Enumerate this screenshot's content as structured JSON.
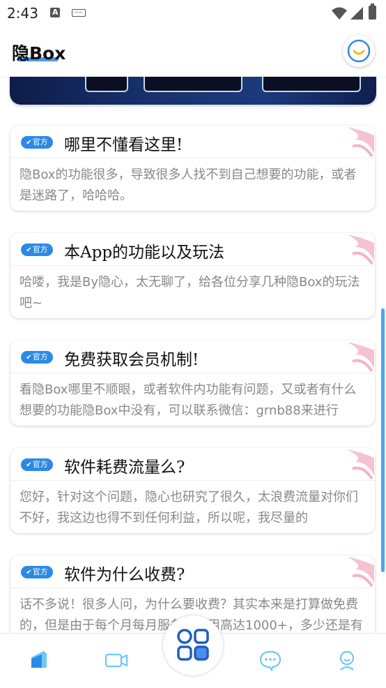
{
  "status_bar": {
    "time": "2:43"
  },
  "header": {
    "title": "隐Box"
  },
  "cards": [
    {
      "badge": "官方",
      "title": "哪里不懂看这里!",
      "body": "隐Box的功能很多，导致很多人找不到自己想要的功能，或者是迷路了，哈哈哈。"
    },
    {
      "badge": "官方",
      "title": "本App的功能以及玩法",
      "body": "哈喽，我是By隐心，太无聊了，给各位分享几种隐Box的玩法吧~"
    },
    {
      "badge": "官方",
      "title": "免费获取会员机制!",
      "body": "看隐Box哪里不顺眼，或者软件内功能有问题，又或者有什么想要的功能隐Box中没有，可以联系微信：grnb88来进行"
    },
    {
      "badge": "官方",
      "title": "软件耗费流量么?",
      "body": "您好，针对这个问题，隐心也研究了很久，太浪费流量对你们不好，我这边也得不到任何利益，所以呢，我尽量的"
    },
    {
      "badge": "官方",
      "title": "软件为什么收费?",
      "body": "话不多说！很多人问，为什么要收费？其实本来是打算做免费的，但是由于每个月每月服务器费用高达1000+，多少还是有"
    }
  ],
  "colors": {
    "accent": "#2a8ae6",
    "icon_light": "#6ec8f2",
    "deco": "#f0a3b7"
  },
  "icons": {
    "nav": [
      "home-icon",
      "video-icon",
      "apps-icon",
      "chat-icon",
      "profile-icon"
    ]
  }
}
